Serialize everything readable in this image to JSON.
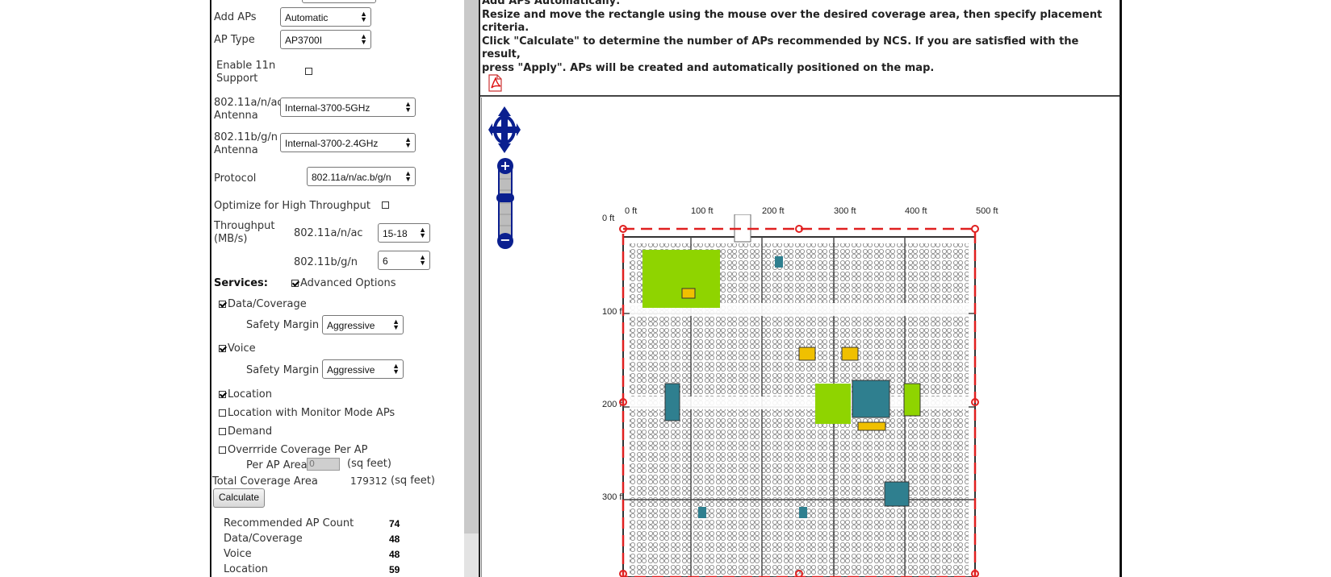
{
  "form": {
    "add_aps_label": "Add APs",
    "add_aps_value": "Automatic",
    "ap_type_label": "AP Type",
    "ap_type_value": "AP3700I",
    "enable_11n_label_1": "Enable 11n",
    "enable_11n_label_2": "Support",
    "antenna_a_label_1": "802.11a/n/ac",
    "antenna_a_label_2": "Antenna",
    "antenna_a_value": "Internal-3700-5GHz",
    "antenna_b_label_1": "802.11b/g/n",
    "antenna_b_label_2": "Antenna",
    "antenna_b_value": "Internal-3700-2.4GHz",
    "protocol_label": "Protocol",
    "protocol_value": "802.11a/n/ac.b/g/n",
    "optimize_label": "Optimize for High Throughput",
    "throughput_label_1": "Throughput",
    "throughput_label_2": "(MB/s)",
    "throughput_a_label": "802.11a/n/ac",
    "throughput_a_value": "15-18",
    "throughput_b_label": "802.11b/g/n",
    "throughput_b_value": "6",
    "services_label": "Services:",
    "advanced_options_label": "Advanced Options",
    "data_coverage_label": "Data/Coverage",
    "safety_margin_label": "Safety Margin",
    "safety_margin_1_value": "Aggressive",
    "voice_label": "Voice",
    "safety_margin_2_value": "Aggressive",
    "location_label": "Location",
    "location_monitor_label": "Location with Monitor Mode APs",
    "demand_label": "Demand",
    "override_label": "Overrride Coverage Per AP",
    "per_ap_area_label": "Per AP Area",
    "per_ap_area_value": "0",
    "sq_feet_1": "(sq feet)",
    "total_coverage_label": "Total Coverage Area",
    "total_coverage_value": "179312",
    "sq_feet_2": "(sq feet)",
    "calculate_label": "Calculate"
  },
  "results": [
    {
      "label": "Recommended AP Count",
      "value": "74"
    },
    {
      "label": "Data/Coverage",
      "value": "48"
    },
    {
      "label": "Voice",
      "value": "48"
    },
    {
      "label": "Location",
      "value": "59"
    }
  ],
  "instructions": {
    "heading": "Add APs Automatically:",
    "line1": "Resize and move the rectangle using the mouse over the desired coverage area, then specify placement criteria.",
    "line2": "Click \"Calculate\" to determine the number of APs recommended by NCS.  If  you are satisfied with the result,",
    "line3": "press \"Apply\". APs will be created and automatically positioned on the map."
  },
  "map": {
    "x_ticks": [
      "0 ft",
      "100 ft",
      "200 ft",
      "300 ft",
      "400 ft",
      "500 ft"
    ],
    "y_ticks": [
      "0 ft",
      "100 ft",
      "200 ft",
      "300 ft"
    ],
    "zoom_in_symbol": "+",
    "zoom_out_symbol": "−"
  },
  "icons": {
    "pdf": "pdf-icon",
    "pan": "pan-control-icon",
    "zoom_in": "zoom-in-icon",
    "zoom_out": "zoom-out-icon"
  },
  "colors": {
    "accent_navy": "#0a1f8f",
    "coverage_green": "#8fd400",
    "rect_red": "#e02020"
  }
}
